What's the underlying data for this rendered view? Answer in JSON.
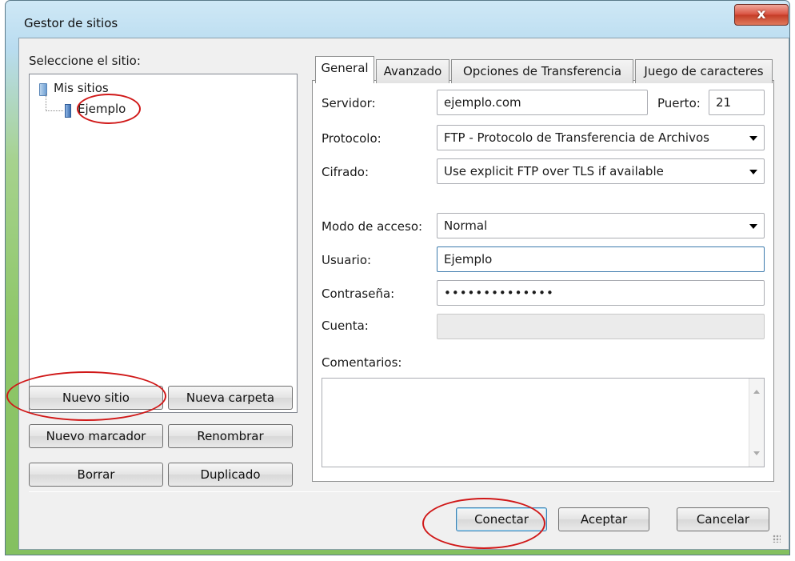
{
  "window": {
    "title": "Gestor de sitios",
    "close_glyph": "x"
  },
  "sites": {
    "label": "Seleccione el sitio:",
    "root": "Mis sitios",
    "child": "Ejemplo"
  },
  "left_buttons": {
    "new_site": "Nuevo sitio",
    "new_folder": "Nueva carpeta",
    "new_bookmark": "Nuevo marcador",
    "rename": "Renombrar",
    "delete": "Borrar",
    "duplicate": "Duplicado"
  },
  "tabs": [
    {
      "label": "General"
    },
    {
      "label": "Avanzado"
    },
    {
      "label": "Opciones de Transferencia"
    },
    {
      "label": "Juego de caracteres"
    }
  ],
  "general": {
    "server_label": "Servidor:",
    "server_value": "ejemplo.com",
    "port_label": "Puerto:",
    "port_value": "21",
    "protocol_label": "Protocolo:",
    "protocol_value": "FTP - Protocolo de Transferencia de Archivos",
    "encryption_label": "Cifrado:",
    "encryption_value": "Use explicit FTP over TLS if available",
    "logon_label": "Modo de acceso:",
    "logon_value": "Normal",
    "user_label": "Usuario:",
    "user_value": "Ejemplo",
    "password_label": "Contraseña:",
    "password_value": "••••••••••••••",
    "account_label": "Cuenta:",
    "account_value": "",
    "comments_label": "Comentarios:"
  },
  "bottom_buttons": {
    "connect": "Conectar",
    "ok": "Aceptar",
    "cancel": "Cancelar"
  },
  "colors": {
    "annotation": "#d01818",
    "focus": "#3d7bad"
  }
}
